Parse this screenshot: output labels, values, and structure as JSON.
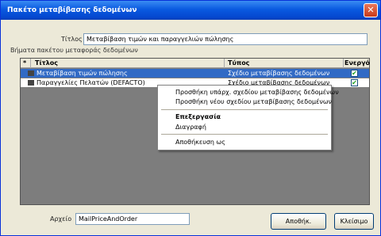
{
  "window": {
    "title": "Πακέτο μεταβίβασης δεδομένων",
    "close_glyph": "✕"
  },
  "form": {
    "title_label": "Τίτλος",
    "title_value": "Μεταβίβαση τιμών και παραγγελιών πώλησης",
    "group_label": "Βήματα πακέτου μεταφοράς δεδομένων",
    "file_label": "Αρχείο",
    "file_value": "MailPriceAndOrder"
  },
  "table": {
    "row_indicator": "*",
    "columns": [
      "Τίτλος",
      "Τύπος",
      "Ενεργό"
    ],
    "rows": [
      {
        "title": "Μεταβίβαση τιμών πώλησης",
        "type": "Σχέδιο μεταβίβασης δεδομένων",
        "active": true,
        "check": "✔",
        "selected": true
      },
      {
        "title": "Παραγγελίες Πελατών (DEFACTO)",
        "type": "Σχέδιο μεταβίβασης δεδομένων",
        "active": true,
        "check": "✔",
        "selected": false
      }
    ]
  },
  "context_menu": {
    "items": [
      "Προσθήκη υπάρχ. σχεδίου μεταβίβασης δεδομένων",
      "Προσθήκη νέου σχεδίου μεταβίβασης δεδομένων",
      "Επεξεργασία",
      "Διαγραφή",
      "Αποθήκευση ως"
    ]
  },
  "buttons": {
    "save": "Αποθήκ.",
    "close": "Κλείσιμο"
  }
}
